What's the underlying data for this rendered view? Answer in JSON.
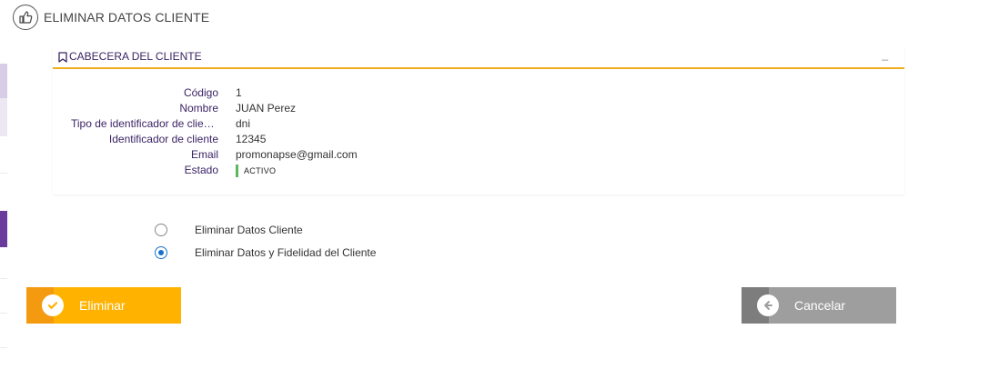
{
  "page": {
    "title": "ELIMINAR DATOS CLIENTE",
    "title_icon": "thumbs-up-icon"
  },
  "panel": {
    "title": "CABECERA DEL CLIENTE",
    "title_icon": "bookmark-icon",
    "collapse_label": "_",
    "accent_color": "#f0ad1e",
    "fields": [
      {
        "label": "Código",
        "value": "1"
      },
      {
        "label": "Nombre",
        "value": "JUAN Perez"
      },
      {
        "label": "Tipo de identificador de cliente",
        "value": "dni"
      },
      {
        "label": "Identificador de cliente",
        "value": "12345"
      },
      {
        "label": "Email",
        "value": "promonapse@gmail.com"
      },
      {
        "label": "Estado",
        "value": "ACTIVO",
        "status_color": "#5cb85c"
      }
    ]
  },
  "options": [
    {
      "label": "Eliminar Datos Cliente",
      "checked": false
    },
    {
      "label": "Eliminar Datos y Fidelidad del Cliente",
      "checked": true
    }
  ],
  "buttons": {
    "delete": {
      "label": "Eliminar",
      "icon": "check-circle-icon",
      "color": "#ffb300"
    },
    "cancel": {
      "label": "Cancelar",
      "icon": "arrow-left-circle-icon",
      "color": "#9e9e9e"
    }
  }
}
